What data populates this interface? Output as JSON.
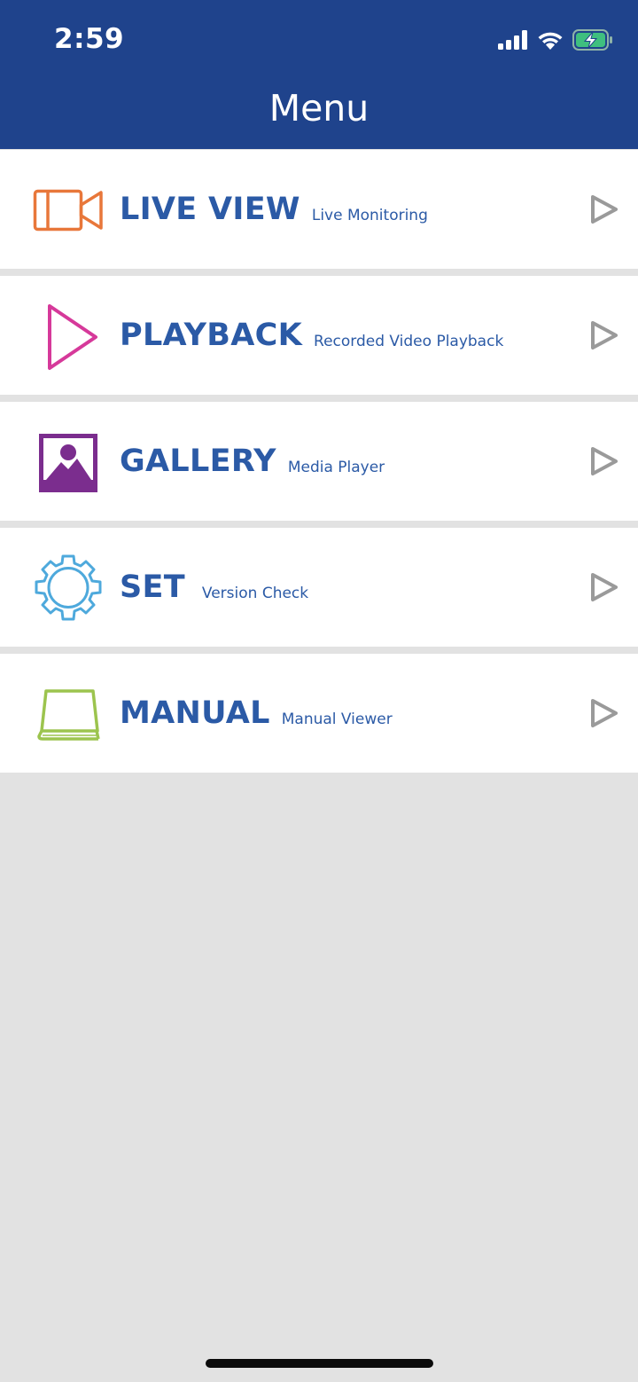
{
  "status_bar": {
    "time": "2:59",
    "icons": [
      "cellular-signal-icon",
      "wifi-icon",
      "battery-charging-icon"
    ]
  },
  "header": {
    "title": "Menu"
  },
  "colors": {
    "header_bg": "#1f438c",
    "label_blue": "#2b5aa6",
    "live_view_icon": "#e8773a",
    "playback_icon": "#d6399a",
    "gallery_icon": "#7b2d8e",
    "set_icon": "#4ea9dc",
    "manual_icon": "#9cc44e",
    "arrow_gray": "#9a9a9a"
  },
  "menu": {
    "items": [
      {
        "label": "LIVE VIEW",
        "sub": "Live Monitoring",
        "icon": "video-camera-icon"
      },
      {
        "label": "PLAYBACK",
        "sub": "Recorded Video Playback",
        "icon": "play-icon"
      },
      {
        "label": "GALLERY",
        "sub": "Media Player",
        "icon": "gallery-image-icon"
      },
      {
        "label": "SET",
        "sub": "Version Check",
        "icon": "gear-icon"
      },
      {
        "label": "MANUAL",
        "sub": "Manual Viewer",
        "icon": "book-icon"
      }
    ]
  }
}
